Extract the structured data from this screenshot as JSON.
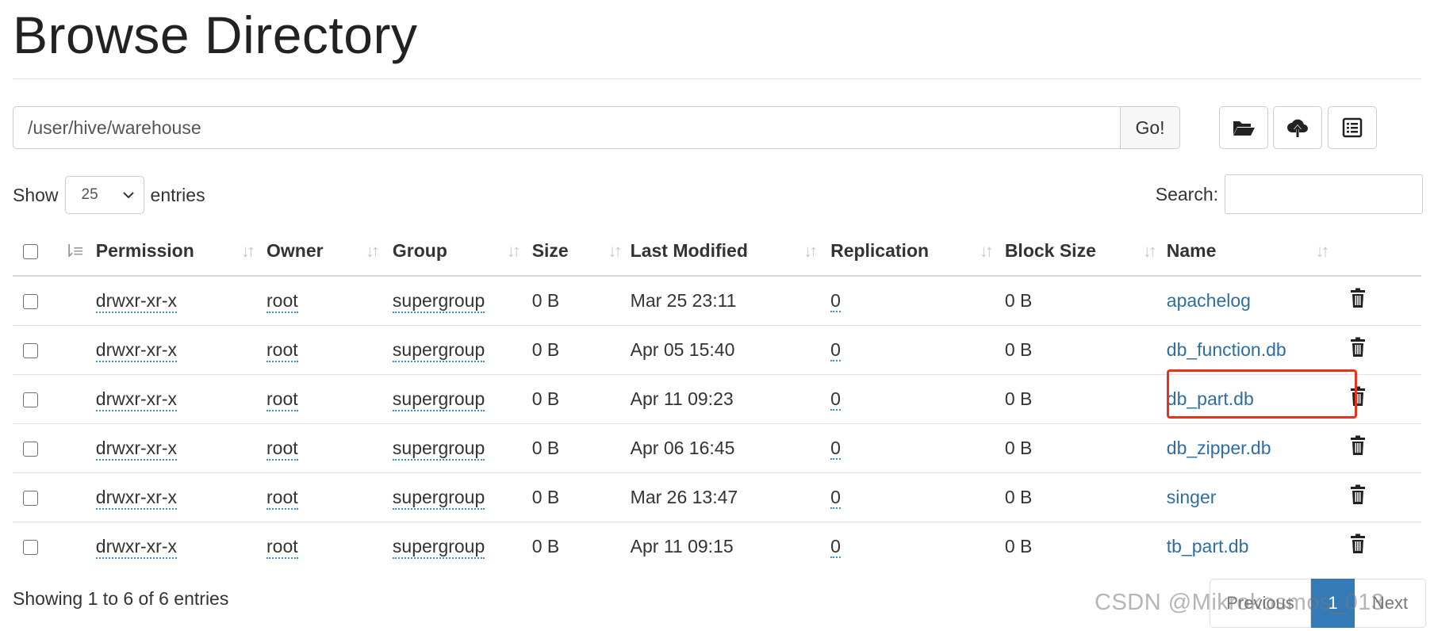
{
  "page": {
    "title": "Browse Directory"
  },
  "path_bar": {
    "value": "/user/hive/warehouse",
    "go_label": "Go!"
  },
  "toolbar": {
    "icons": [
      "folder-open-icon",
      "cloud-upload-icon",
      "list-alt-icon"
    ]
  },
  "show_entries": {
    "show_label": "Show",
    "selected": "25",
    "entries_label": "entries"
  },
  "search": {
    "label": "Search:",
    "value": ""
  },
  "table": {
    "columns": [
      "Permission",
      "Owner",
      "Group",
      "Size",
      "Last Modified",
      "Replication",
      "Block Size",
      "Name"
    ],
    "rows": [
      {
        "permission": "drwxr-xr-x",
        "owner": "root",
        "group": "supergroup",
        "size": "0 B",
        "modified": "Mar 25 23:11",
        "replication": "0",
        "block_size": "0 B",
        "name": "apachelog"
      },
      {
        "permission": "drwxr-xr-x",
        "owner": "root",
        "group": "supergroup",
        "size": "0 B",
        "modified": "Apr 05 15:40",
        "replication": "0",
        "block_size": "0 B",
        "name": "db_function.db"
      },
      {
        "permission": "drwxr-xr-x",
        "owner": "root",
        "group": "supergroup",
        "size": "0 B",
        "modified": "Apr 11 09:23",
        "replication": "0",
        "block_size": "0 B",
        "name": "db_part.db"
      },
      {
        "permission": "drwxr-xr-x",
        "owner": "root",
        "group": "supergroup",
        "size": "0 B",
        "modified": "Apr 06 16:45",
        "replication": "0",
        "block_size": "0 B",
        "name": "db_zipper.db"
      },
      {
        "permission": "drwxr-xr-x",
        "owner": "root",
        "group": "supergroup",
        "size": "0 B",
        "modified": "Mar 26 13:47",
        "replication": "0",
        "block_size": "0 B",
        "name": "singer"
      },
      {
        "permission": "drwxr-xr-x",
        "owner": "root",
        "group": "supergroup",
        "size": "0 B",
        "modified": "Apr 11 09:15",
        "replication": "0",
        "block_size": "0 B",
        "name": "tb_part.db"
      }
    ]
  },
  "footer": {
    "info": "Showing 1 to 6 of 6 entries"
  },
  "pagination": {
    "previous": "Previous",
    "current": "1",
    "next": "Next"
  },
  "watermark": "CSDN @Mikrokosmos_013",
  "colors": {
    "link": "#2e6da4",
    "active_page": "#337ab7",
    "highlight_box": "#e8331c"
  }
}
